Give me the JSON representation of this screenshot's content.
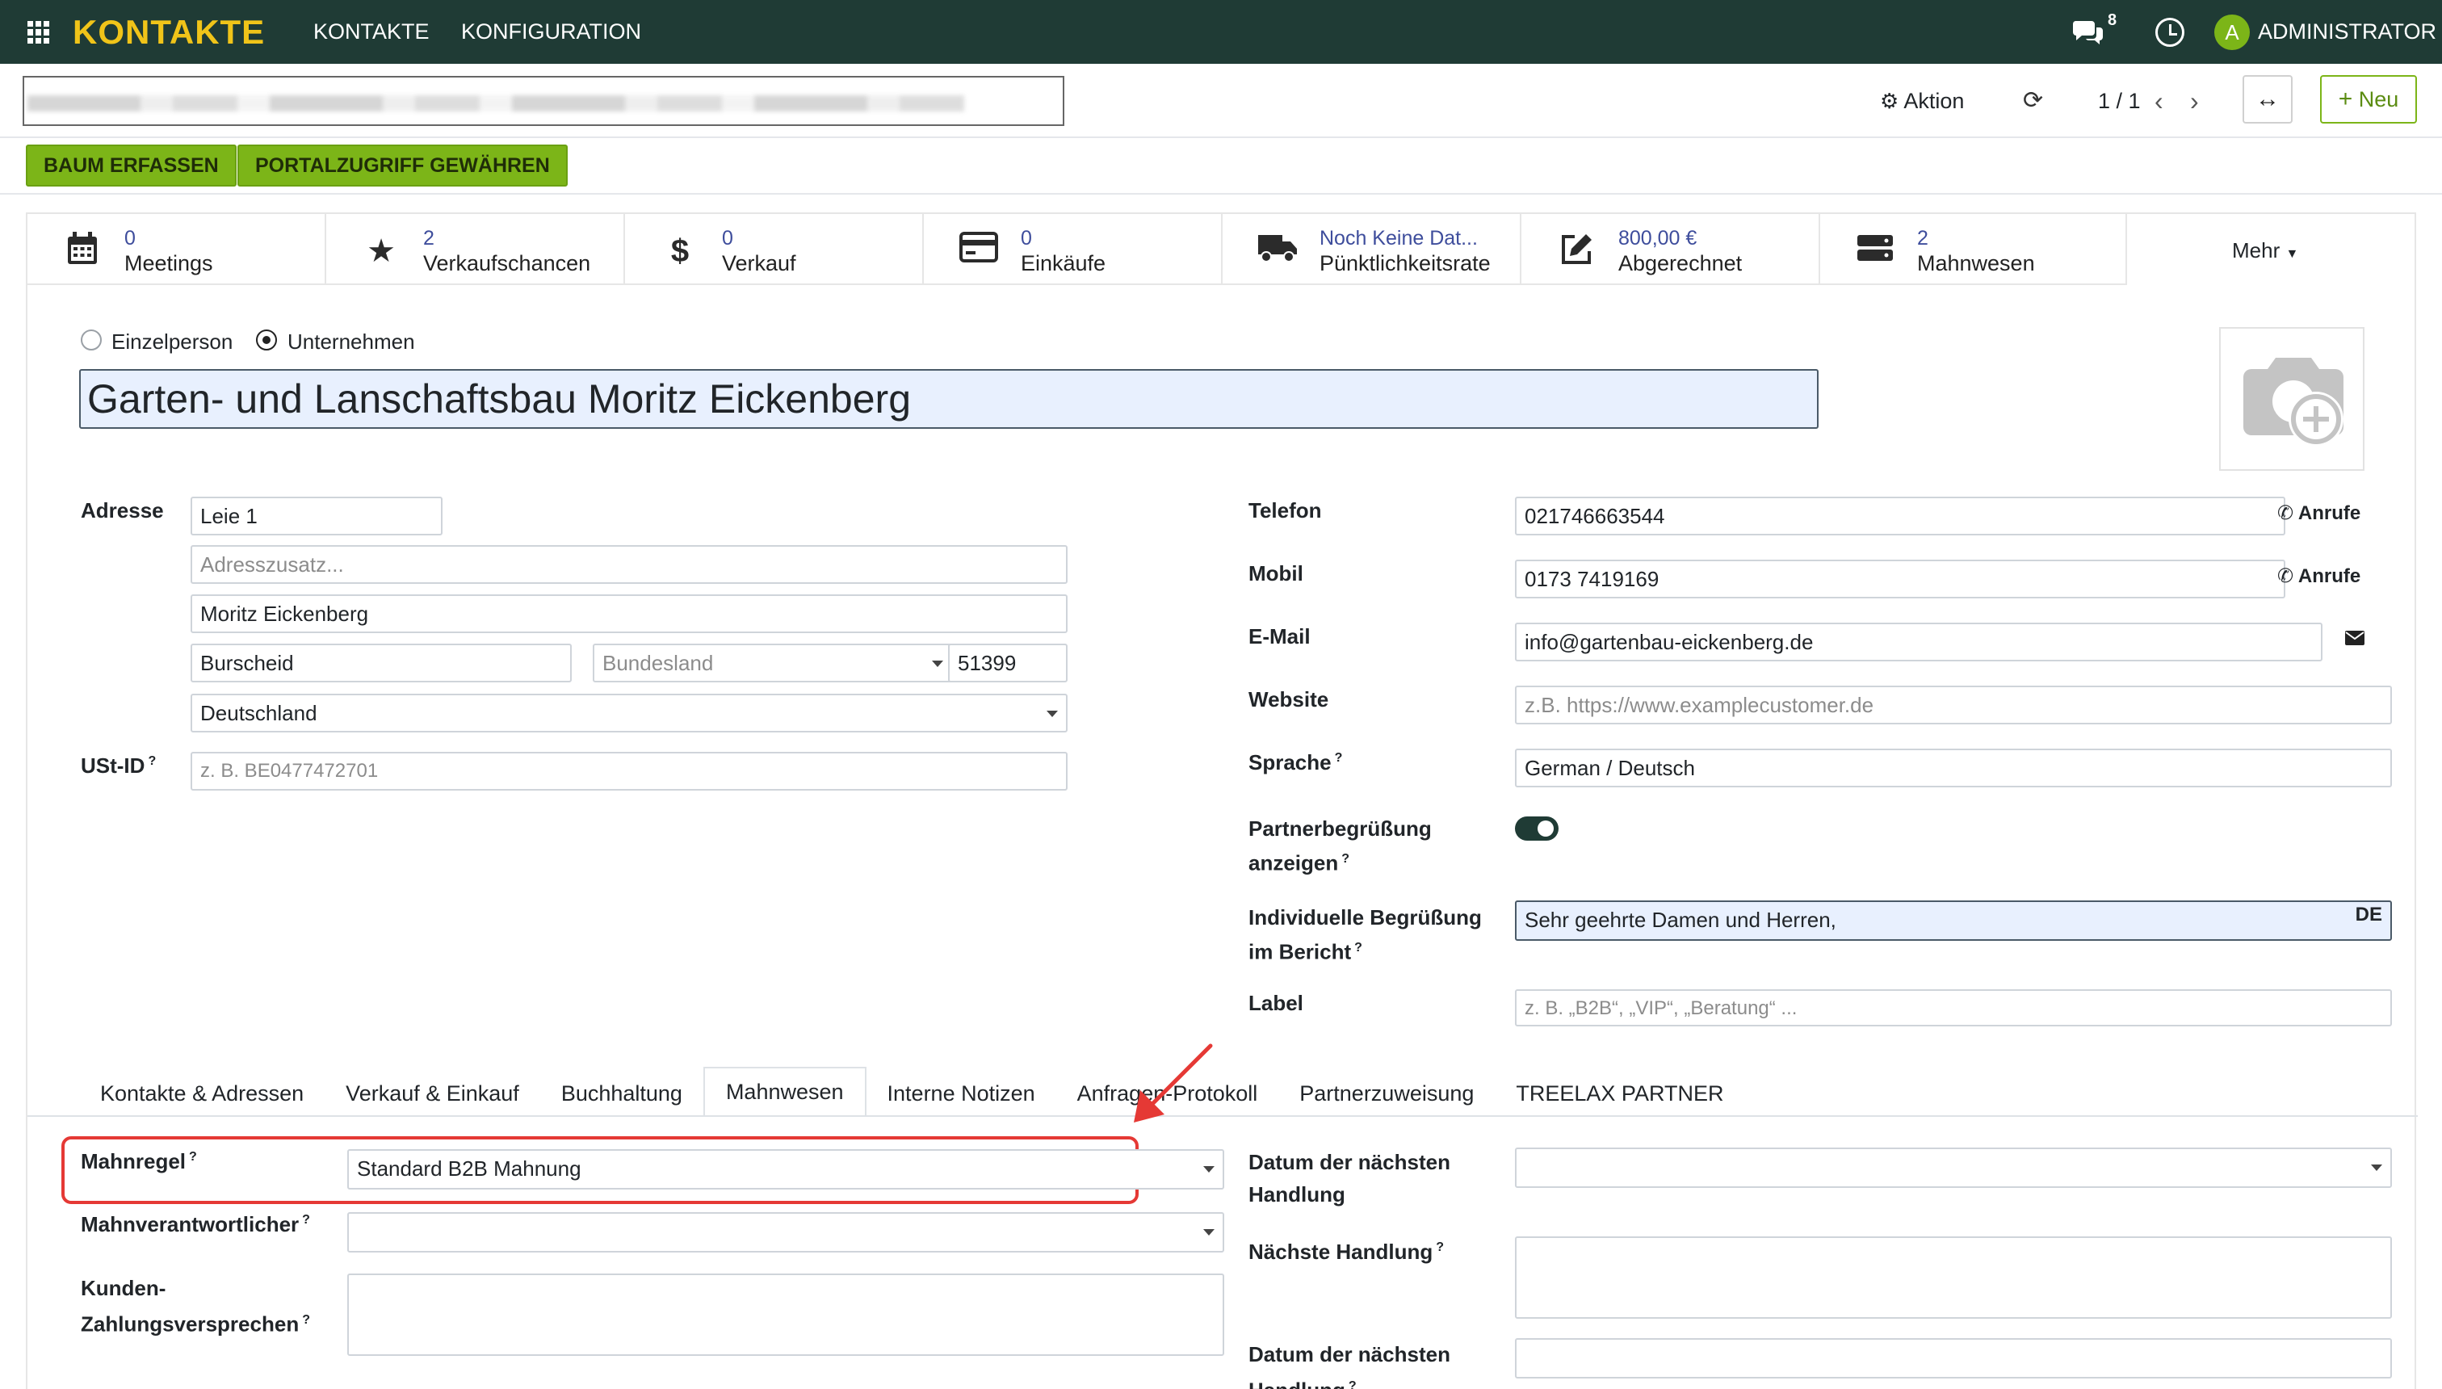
{
  "nav": {
    "app": "KONTAKTE",
    "menu_contacts": "KONTAKTE",
    "menu_config": "KONFIGURATION",
    "badge": "8",
    "user_initial": "A",
    "user": "ADMINISTRATOR"
  },
  "control": {
    "action": "Aktion",
    "pager": "1 / 1",
    "new": "Neu"
  },
  "buttons": {
    "tree": "BAUM ERFASSEN",
    "portal": "PORTALZUGRIFF GEWÄHREN"
  },
  "smart": [
    {
      "value": "0",
      "label": "Meetings",
      "icon": "calendar-icon"
    },
    {
      "value": "2",
      "label": "Verkaufschancen",
      "icon": "star-icon"
    },
    {
      "value": "0",
      "label": "Verkauf",
      "icon": "dollar-icon"
    },
    {
      "value": "0",
      "label": "Einkäufe",
      "icon": "credit-card-icon"
    },
    {
      "value": "Noch Keine Dat...",
      "label": "Pünktlichkeitsrate",
      "icon": "truck-icon"
    },
    {
      "value": "800,00 €",
      "label": "Abgerechnet",
      "icon": "edit-icon"
    },
    {
      "value": "2",
      "label": "Mahnwesen",
      "icon": "server-icon"
    }
  ],
  "more": "Mehr",
  "type": {
    "person": "Einzelperson",
    "company": "Unternehmen"
  },
  "name": "Garten- und Lanschaftsbau Moritz Eickenberg",
  "address": {
    "label": "Adresse",
    "street": "Leie 1",
    "street2_ph": "Adresszusatz...",
    "contact": "Moritz Eickenberg",
    "city": "Burscheid",
    "state_ph": "Bundesland",
    "zip": "51399",
    "country": "Deutschland"
  },
  "vat": {
    "label": "USt-ID",
    "ph": "z. B. BE0477472701",
    "sup": "?"
  },
  "right": {
    "phone_label": "Telefon",
    "phone": "021746663544",
    "call": "Anrufe",
    "mobile_label": "Mobil",
    "mobile": "0173 7419169",
    "email_label": "E-Mail",
    "email": "info@gartenbau-eickenberg.de",
    "website_label": "Website",
    "website_ph": "z.B. https://www.examplecustomer.de",
    "lang_label": "Sprache",
    "lang": "German / Deutsch",
    "greet_l1": "Partnerbegrüßung",
    "greet_l2": "anzeigen",
    "indiv_l1": "Individuelle Begrüßung",
    "indiv_l2": "im Bericht",
    "indiv": "Sehr geehrte Damen und Herren,",
    "indiv_lang": "DE",
    "label_label": "Label",
    "label_ph": "z. B. „B2B“, „VIP“, „Beratung“ ..."
  },
  "tabs": [
    "Kontakte & Adressen",
    "Verkauf & Einkauf",
    "Buchhaltung",
    "Mahnwesen",
    "Interne Notizen",
    "Anfragen-Protokoll",
    "Partnerzuweisung",
    "TREELAX PARTNER"
  ],
  "dunning": {
    "rule_label": "Mahnregel",
    "rule": "Standard B2B Mahnung",
    "resp_label": "Mahnverantwortlicher",
    "promise_l1": "Kunden-",
    "promise_l2": "Zahlungsversprechen",
    "next_date_l1": "Datum der nächsten",
    "next_date_l2": "Handlung",
    "next_action": "Nächste Handlung",
    "next_date2_l1": "Datum der nächsten",
    "next_date2_l2": "Handlung"
  },
  "colors": {
    "navbar": "#1f3b35",
    "brand": "#f0c419",
    "accent": "#7cb518",
    "highlight": "#e53935"
  }
}
